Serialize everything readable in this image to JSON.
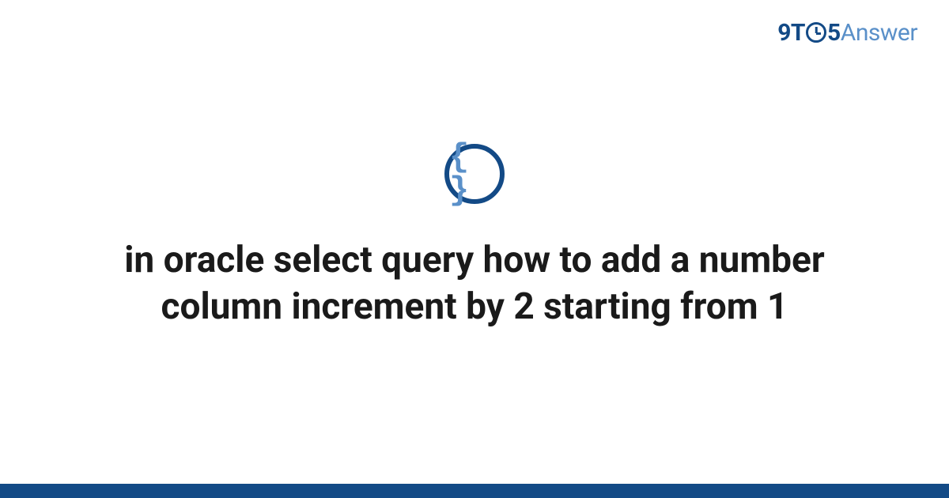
{
  "brand": {
    "prefix": "9T",
    "middle": "5",
    "suffix": "Answer"
  },
  "icon": {
    "name": "code-braces",
    "glyph": "{ }"
  },
  "title": "in oracle select query how to add a number column increment by 2 starting from 1",
  "colors": {
    "primary": "#134a86",
    "accent": "#5a90c9"
  }
}
